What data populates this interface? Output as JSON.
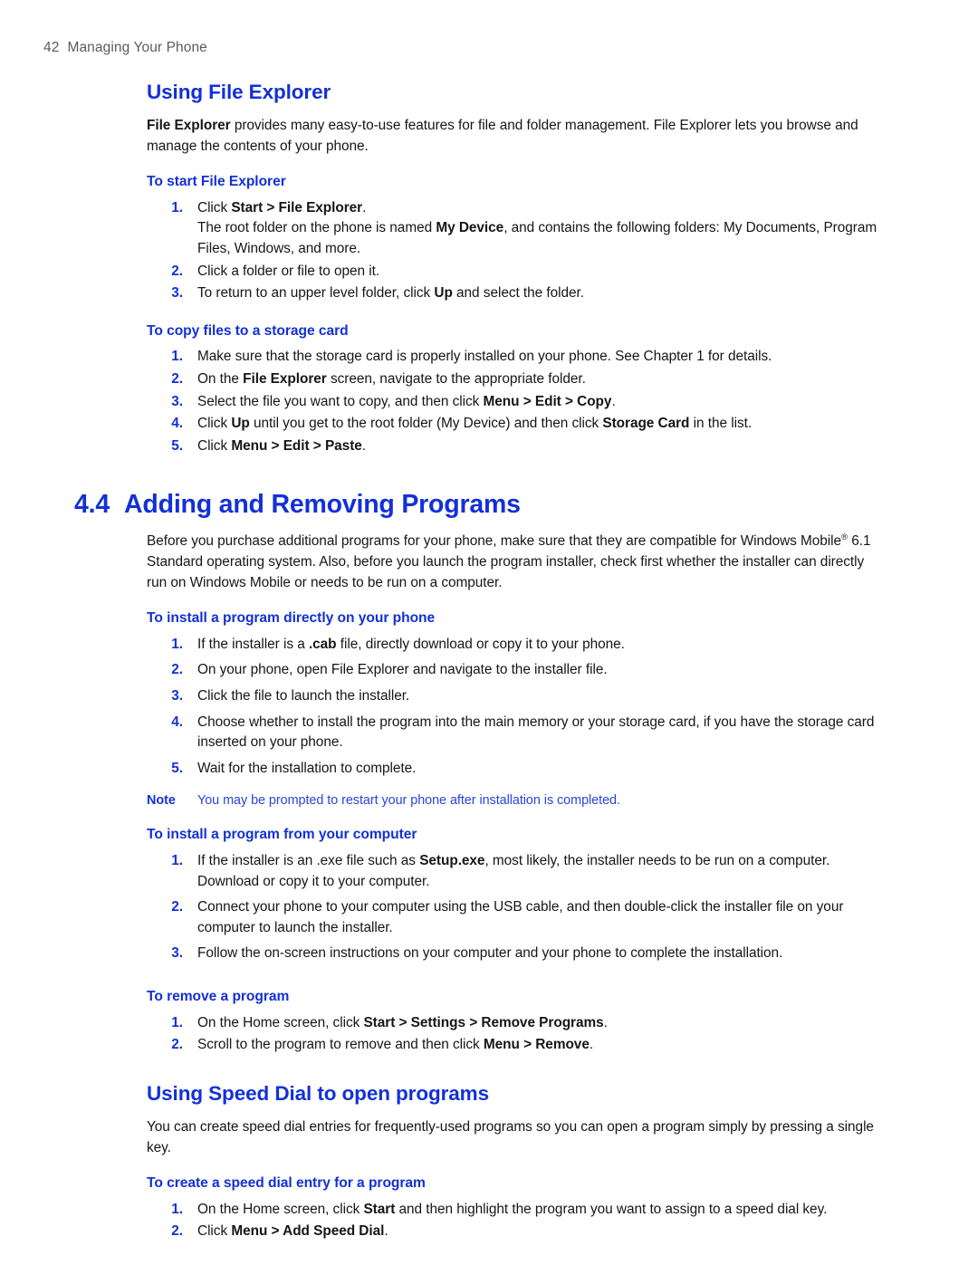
{
  "header": {
    "page_number": "42",
    "title": "Managing Your Phone"
  },
  "colors": {
    "heading_blue": "#1330d8",
    "note_blue": "#2a44dd",
    "body_black": "#161616",
    "header_gray": "#5b5b5b"
  },
  "topic_file_explorer": {
    "heading": "Using File Explorer",
    "intro_bold": "File Explorer",
    "intro_rest": " provides many easy-to-use features for file and folder management. File Explorer lets you browse and manage the contents of your phone."
  },
  "start_file_explorer": {
    "heading": "To start File Explorer",
    "steps": [
      {
        "num": "1.",
        "parts": [
          {
            "t": "Click ",
            "b": false
          },
          {
            "t": "Start > File Explorer",
            "b": true
          },
          {
            "t": ".",
            "b": false
          }
        ],
        "continuation": "The root folder on the phone is named |B|My Device|/B|, and contains the following folders: My Documents, Program Files, Windows, and more."
      },
      {
        "num": "2.",
        "parts": [
          {
            "t": "Click a folder or file to open it.",
            "b": false
          }
        ]
      },
      {
        "num": "3.",
        "parts": [
          {
            "t": "To return to an upper level folder, click ",
            "b": false
          },
          {
            "t": "Up",
            "b": true
          },
          {
            "t": " and select the folder.",
            "b": false
          }
        ]
      }
    ]
  },
  "copy_to_storage": {
    "heading": "To copy files to a storage card",
    "steps": [
      {
        "num": "1.",
        "parts": [
          {
            "t": "Make sure that the storage card is properly installed on your phone. See Chapter 1 for details.",
            "b": false
          }
        ]
      },
      {
        "num": "2.",
        "parts": [
          {
            "t": "On the ",
            "b": false
          },
          {
            "t": "File Explorer",
            "b": true
          },
          {
            "t": " screen, navigate to the appropriate folder.",
            "b": false
          }
        ]
      },
      {
        "num": "3.",
        "parts": [
          {
            "t": "Select the file you want to copy, and then click ",
            "b": false
          },
          {
            "t": "Menu > Edit > Copy",
            "b": true
          },
          {
            "t": ".",
            "b": false
          }
        ]
      },
      {
        "num": "4.",
        "parts": [
          {
            "t": "Click ",
            "b": false
          },
          {
            "t": "Up",
            "b": true
          },
          {
            "t": " until you get to the root folder (My Device) and then click ",
            "b": false
          },
          {
            "t": "Storage Card",
            "b": true
          },
          {
            "t": " in the list.",
            "b": false
          }
        ]
      },
      {
        "num": "5.",
        "parts": [
          {
            "t": "Click ",
            "b": false
          },
          {
            "t": "Menu > Edit > Paste",
            "b": true
          },
          {
            "t": ".",
            "b": false
          }
        ]
      }
    ]
  },
  "section_4_4": {
    "number": "4.4",
    "title": "Adding and Removing Programs",
    "intro_before_reg": "Before you purchase additional programs for your phone, make sure that they are compatible for Windows Mobile",
    "registered_mark": "®",
    "intro_after_reg": " 6.1 Standard operating system. Also, before you launch the program installer, check first whether the installer can directly run on Windows Mobile or needs to be run on a computer."
  },
  "install_on_phone": {
    "heading": "To install a program directly on your phone",
    "steps": [
      {
        "num": "1.",
        "parts": [
          {
            "t": "If the installer is a ",
            "b": false
          },
          {
            "t": ".cab",
            "b": true
          },
          {
            "t": " file, directly download or copy it to your phone.",
            "b": false
          }
        ]
      },
      {
        "num": "2.",
        "parts": [
          {
            "t": "On your phone, open File Explorer and navigate to the installer file.",
            "b": false
          }
        ]
      },
      {
        "num": "3.",
        "parts": [
          {
            "t": "Click the file to launch the installer.",
            "b": false
          }
        ]
      },
      {
        "num": "4.",
        "parts": [
          {
            "t": "Choose whether to install the program into the main memory or your storage card, if you have the storage card inserted on your phone.",
            "b": false
          }
        ]
      },
      {
        "num": "5.",
        "parts": [
          {
            "t": "Wait for the installation to complete.",
            "b": false
          }
        ]
      }
    ],
    "note_label": "Note",
    "note_text": "You may be prompted to restart your phone after installation is completed."
  },
  "install_from_computer": {
    "heading": "To install a program from your computer",
    "steps": [
      {
        "num": "1.",
        "parts": [
          {
            "t": "If the installer is an .exe file such as ",
            "b": false
          },
          {
            "t": "Setup.exe",
            "b": true
          },
          {
            "t": ", most likely, the installer needs to be run on a computer. Download or copy it to your computer.",
            "b": false
          }
        ]
      },
      {
        "num": "2.",
        "parts": [
          {
            "t": "Connect your phone to your computer using the USB cable, and then double-click the installer file on your computer to launch the installer.",
            "b": false
          }
        ]
      },
      {
        "num": "3.",
        "parts": [
          {
            "t": "Follow the on-screen instructions on your computer and your phone to complete the installation.",
            "b": false
          }
        ]
      }
    ]
  },
  "remove_program": {
    "heading": "To remove a program",
    "steps": [
      {
        "num": "1.",
        "parts": [
          {
            "t": "On the Home screen, click ",
            "b": false
          },
          {
            "t": "Start > Settings > Remove Programs",
            "b": true
          },
          {
            "t": ".",
            "b": false
          }
        ]
      },
      {
        "num": "2.",
        "parts": [
          {
            "t": "Scroll to the program to remove and then click ",
            "b": false
          },
          {
            "t": "Menu > Remove",
            "b": true
          },
          {
            "t": ".",
            "b": false
          }
        ]
      }
    ]
  },
  "topic_speed_dial": {
    "heading": "Using Speed Dial to open programs",
    "intro": "You can create speed dial entries for frequently-used programs so you can open a program simply by pressing a single key."
  },
  "create_speed_dial": {
    "heading": "To create a speed dial entry for a program",
    "steps": [
      {
        "num": "1.",
        "parts": [
          {
            "t": "On the Home screen, click ",
            "b": false
          },
          {
            "t": "Start",
            "b": true
          },
          {
            "t": " and then highlight the program you want to assign to a speed dial key.",
            "b": false
          }
        ]
      },
      {
        "num": "2.",
        "parts": [
          {
            "t": "Click ",
            "b": false
          },
          {
            "t": "Menu > Add Speed Dial",
            "b": true
          },
          {
            "t": ".",
            "b": false
          }
        ]
      }
    ]
  }
}
